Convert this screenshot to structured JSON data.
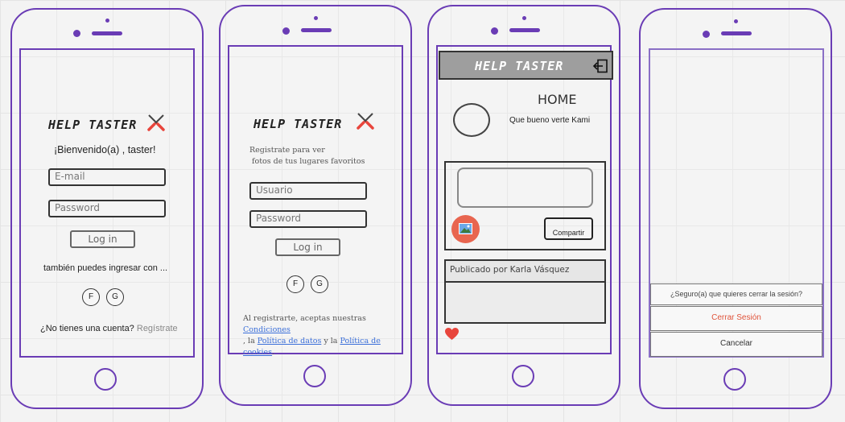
{
  "screen1": {
    "logo": "HELP TASTER",
    "welcome": "¡Bienvenido(a) , taster!",
    "email_placeholder": "E-mail",
    "password_placeholder": "Password",
    "login_label": "Log in",
    "alt_login_text": "también puedes ingresar con ...",
    "social_f": "F",
    "social_g": "G",
    "no_account_text": "¿No tienes una cuenta?",
    "register_link": "Regístrate"
  },
  "screen2": {
    "logo": "HELP TASTER",
    "intro_line1": "Registrate para ver",
    "intro_line2": "fotos de tus lugares favoritos",
    "user_placeholder": "Usuario",
    "password_placeholder": "Password",
    "login_label": "Log in",
    "social_f": "F",
    "social_g": "G",
    "terms_prefix": "Al registrarte, aceptas nuestras",
    "terms_link": "Condiciones",
    "terms_mid1": ", la",
    "privacy_link": "Política de datos",
    "terms_mid2": "y la",
    "cookies_link": "Política de cookies",
    "terms_end": "."
  },
  "screen3": {
    "logo": "HELP TASTER",
    "title": "HOME",
    "greeting": "Que bueno verte Kami",
    "share_label": "Compartir",
    "post_author": "Publicado por Karla Vásquez"
  },
  "screen4": {
    "confirm_text": "¿Seguro(a) que quieres cerrar la sesión?",
    "logout_label": "Cerrar Sesión",
    "cancel_label": "Cancelar"
  },
  "colors": {
    "frame": "#6a3cb5",
    "header_gray": "#9e9e9e",
    "heart": "#e8453c",
    "photo_button": "#e8654f",
    "logout_red": "#e0533a",
    "link_blue": "#3b6fd9"
  },
  "icons": [
    "utensils-icon",
    "logout-icon",
    "image-icon",
    "heart-icon"
  ]
}
